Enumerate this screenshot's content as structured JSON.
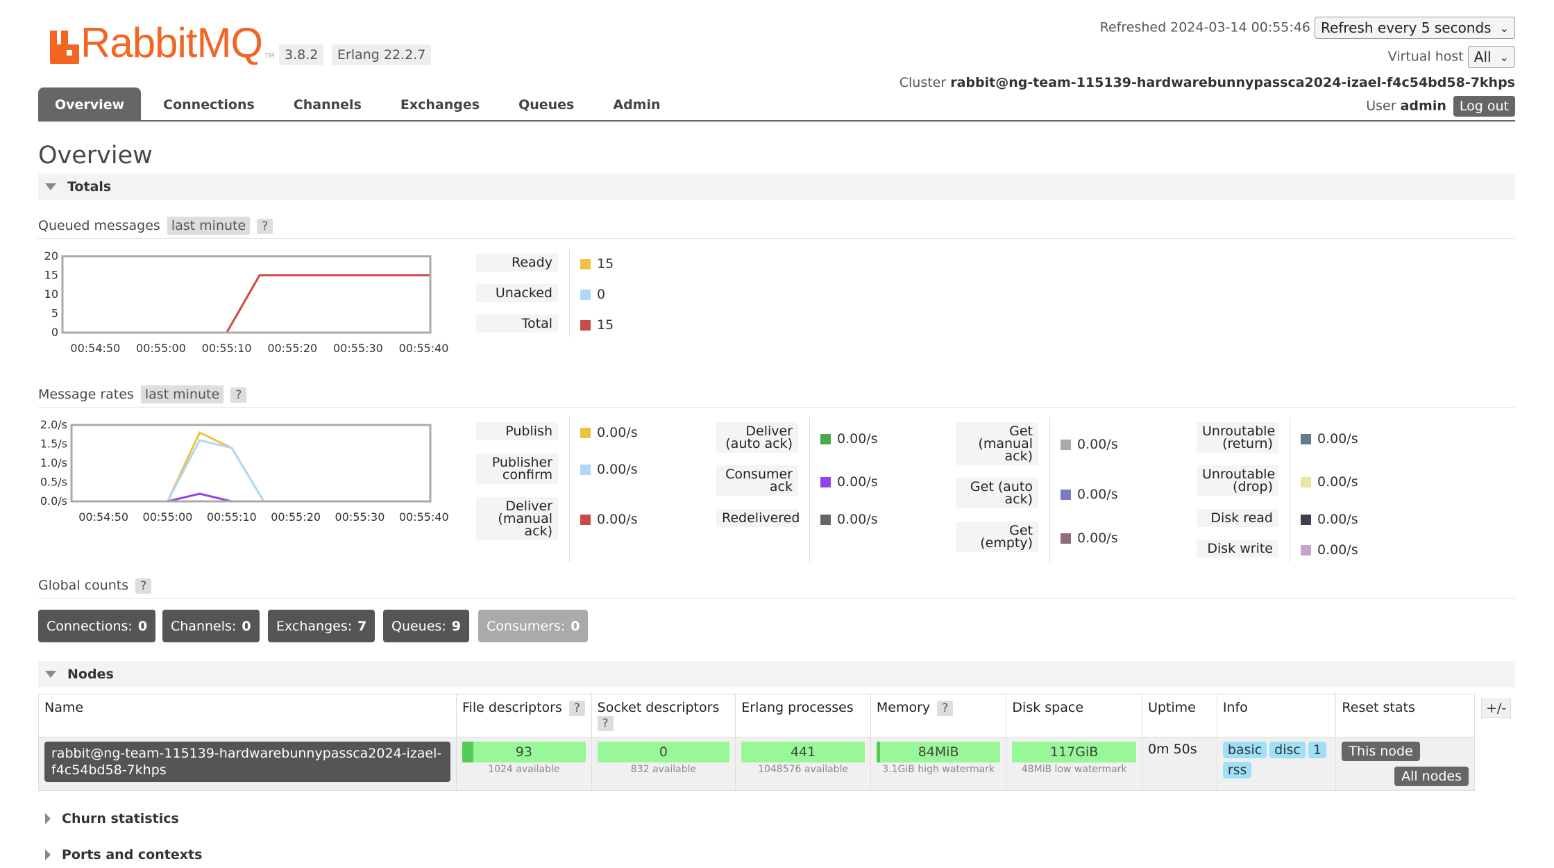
{
  "app": {
    "logo_text": "RabbitMQ",
    "logo_tm": "TM",
    "version": "3.8.2",
    "erlang": "Erlang 22.2.7",
    "brand_color": "#f26522"
  },
  "header": {
    "refreshed_label": "Refreshed 2024-03-14 00:55:46",
    "refresh_select": "Refresh every 5 seconds",
    "vhost_label": "Virtual host",
    "vhost_select": "All",
    "cluster_label": "Cluster",
    "cluster_name": "rabbit@ng-team-115139-hardwarebunnypassca2024-izael-f4c54bd58-7khps",
    "user_label": "User",
    "user_name": "admin",
    "logout_label": "Log out"
  },
  "tabs": [
    {
      "label": "Overview",
      "active": true
    },
    {
      "label": "Connections"
    },
    {
      "label": "Channels"
    },
    {
      "label": "Exchanges"
    },
    {
      "label": "Queues"
    },
    {
      "label": "Admin"
    }
  ],
  "page_title": "Overview",
  "totals": {
    "title": "Totals",
    "queued": {
      "label": "Queued messages",
      "range": "last minute",
      "help": "?",
      "legend": [
        {
          "label": "Ready",
          "value": "15",
          "color": "#edc240"
        },
        {
          "label": "Unacked",
          "value": "0",
          "color": "#afd8f8"
        },
        {
          "label": "Total",
          "value": "15",
          "color": "#cb4b4b"
        }
      ]
    },
    "rates": {
      "label": "Message rates",
      "range": "last minute",
      "help": "?",
      "col1": [
        {
          "label": "Publish",
          "value": "0.00/s",
          "color": "#edc240"
        },
        {
          "label": "Publisher confirm",
          "value": "0.00/s",
          "color": "#afd8f8"
        },
        {
          "label": "Deliver (manual ack)",
          "value": "0.00/s",
          "color": "#cb4b4b"
        }
      ],
      "col2": [
        {
          "label": "Deliver (auto ack)",
          "value": "0.00/s",
          "color": "#4da74d"
        },
        {
          "label": "Consumer ack",
          "value": "0.00/s",
          "color": "#9440ed"
        },
        {
          "label": "Redelivered",
          "value": "0.00/s",
          "color": "#666666"
        }
      ],
      "col3": [
        {
          "label": "Get (manual ack)",
          "value": "0.00/s",
          "color": "#aaaaaa"
        },
        {
          "label": "Get (auto ack)",
          "value": "0.00/s",
          "color": "#7c79c3"
        },
        {
          "label": "Get (empty)",
          "value": "0.00/s",
          "color": "#8d6e7a"
        }
      ],
      "col4": [
        {
          "label": "Unroutable (return)",
          "value": "0.00/s",
          "color": "#637c8a"
        },
        {
          "label": "Unroutable (drop)",
          "value": "0.00/s",
          "color": "#e6e7a1"
        },
        {
          "label": "Disk read",
          "value": "0.00/s",
          "color": "#3f3f50"
        },
        {
          "label": "Disk write",
          "value": "0.00/s",
          "color": "#c6a5cc"
        }
      ]
    },
    "global": {
      "label": "Global counts",
      "help": "?",
      "counts": [
        {
          "label": "Connections:",
          "value": "0"
        },
        {
          "label": "Channels:",
          "value": "0"
        },
        {
          "label": "Exchanges:",
          "value": "7"
        },
        {
          "label": "Queues:",
          "value": "9"
        },
        {
          "label": "Consumers:",
          "value": "0"
        }
      ]
    }
  },
  "chart_data": [
    {
      "type": "line",
      "title": "Queued messages",
      "x": [
        "00:54:50",
        "00:55:00",
        "00:55:10",
        "00:55:20",
        "00:55:30",
        "00:55:40"
      ],
      "ylim": [
        0,
        20
      ],
      "yticks": [
        "20",
        "15",
        "10",
        "5",
        "0"
      ],
      "series": [
        {
          "name": "Ready",
          "color": "#edc240",
          "points": [
            [
              -15,
              0
            ],
            [
              10,
              0
            ],
            [
              15,
              15
            ],
            [
              41,
              15
            ]
          ]
        },
        {
          "name": "Unacked",
          "color": "#afd8f8",
          "points": [
            [
              -15,
              0
            ],
            [
              41,
              0
            ]
          ]
        },
        {
          "name": "Total",
          "color": "#cb4b4b",
          "points": [
            [
              -15,
              0
            ],
            [
              10,
              0
            ],
            [
              15,
              15
            ],
            [
              41,
              15
            ]
          ]
        }
      ]
    },
    {
      "type": "line",
      "title": "Message rates",
      "x": [
        "00:54:50",
        "00:55:00",
        "00:55:10",
        "00:55:20",
        "00:55:30",
        "00:55:40"
      ],
      "ylim": [
        0,
        2
      ],
      "yticks": [
        "2.0/s",
        "1.5/s",
        "1.0/s",
        "0.5/s",
        "0.0/s"
      ],
      "series": [
        {
          "name": "Publish",
          "color": "#edc240",
          "points": [
            [
              -15,
              0
            ],
            [
              0,
              0
            ],
            [
              5,
              1.8
            ],
            [
              10,
              1.4
            ],
            [
              15,
              0
            ],
            [
              41,
              0
            ]
          ]
        },
        {
          "name": "Publisher confirm",
          "color": "#afd8f8",
          "points": [
            [
              -15,
              0
            ],
            [
              0,
              0
            ],
            [
              5,
              1.6
            ],
            [
              10,
              1.4
            ],
            [
              15,
              0
            ],
            [
              41,
              0
            ]
          ]
        },
        {
          "name": "Consumer ack",
          "color": "#9440ed",
          "points": [
            [
              -15,
              0
            ],
            [
              0,
              0
            ],
            [
              5,
              0.2
            ],
            [
              10,
              0
            ],
            [
              41,
              0
            ]
          ]
        },
        {
          "name": "Deliver (manual ack)",
          "color": "#cb4b4b",
          "points": [
            [
              -15,
              0
            ],
            [
              41,
              0
            ]
          ]
        }
      ]
    }
  ],
  "nodes": {
    "title": "Nodes",
    "plusminus": "+/-",
    "columns": [
      "Name",
      "File descriptors",
      "Socket descriptors",
      "Erlang processes",
      "Memory",
      "Disk space",
      "Uptime",
      "Info",
      "Reset stats"
    ],
    "help": "?",
    "row": {
      "name": "rabbit@ng-team-115139-hardwarebunnypassca2024-izael-f4c54bd58-7khps",
      "fd_value": "93",
      "fd_sub": "1024 available",
      "fd_fraction": 0.09,
      "sock_value": "0",
      "sock_sub": "832 available",
      "sock_fraction": 0,
      "proc_value": "441",
      "proc_sub": "1048576 available",
      "proc_fraction": 0.0004,
      "mem_value": "84MiB",
      "mem_sub": "3.1GiB high watermark",
      "mem_fraction": 0.03,
      "disk_value": "117GiB",
      "disk_sub": "48MiB low watermark",
      "uptime": "0m 50s",
      "info_tags": [
        "basic",
        "disc",
        "1",
        "rss"
      ],
      "reset_this": "This node",
      "reset_all": "All nodes"
    }
  },
  "churn": {
    "title": "Churn statistics"
  },
  "ports": {
    "title": "Ports and contexts"
  }
}
